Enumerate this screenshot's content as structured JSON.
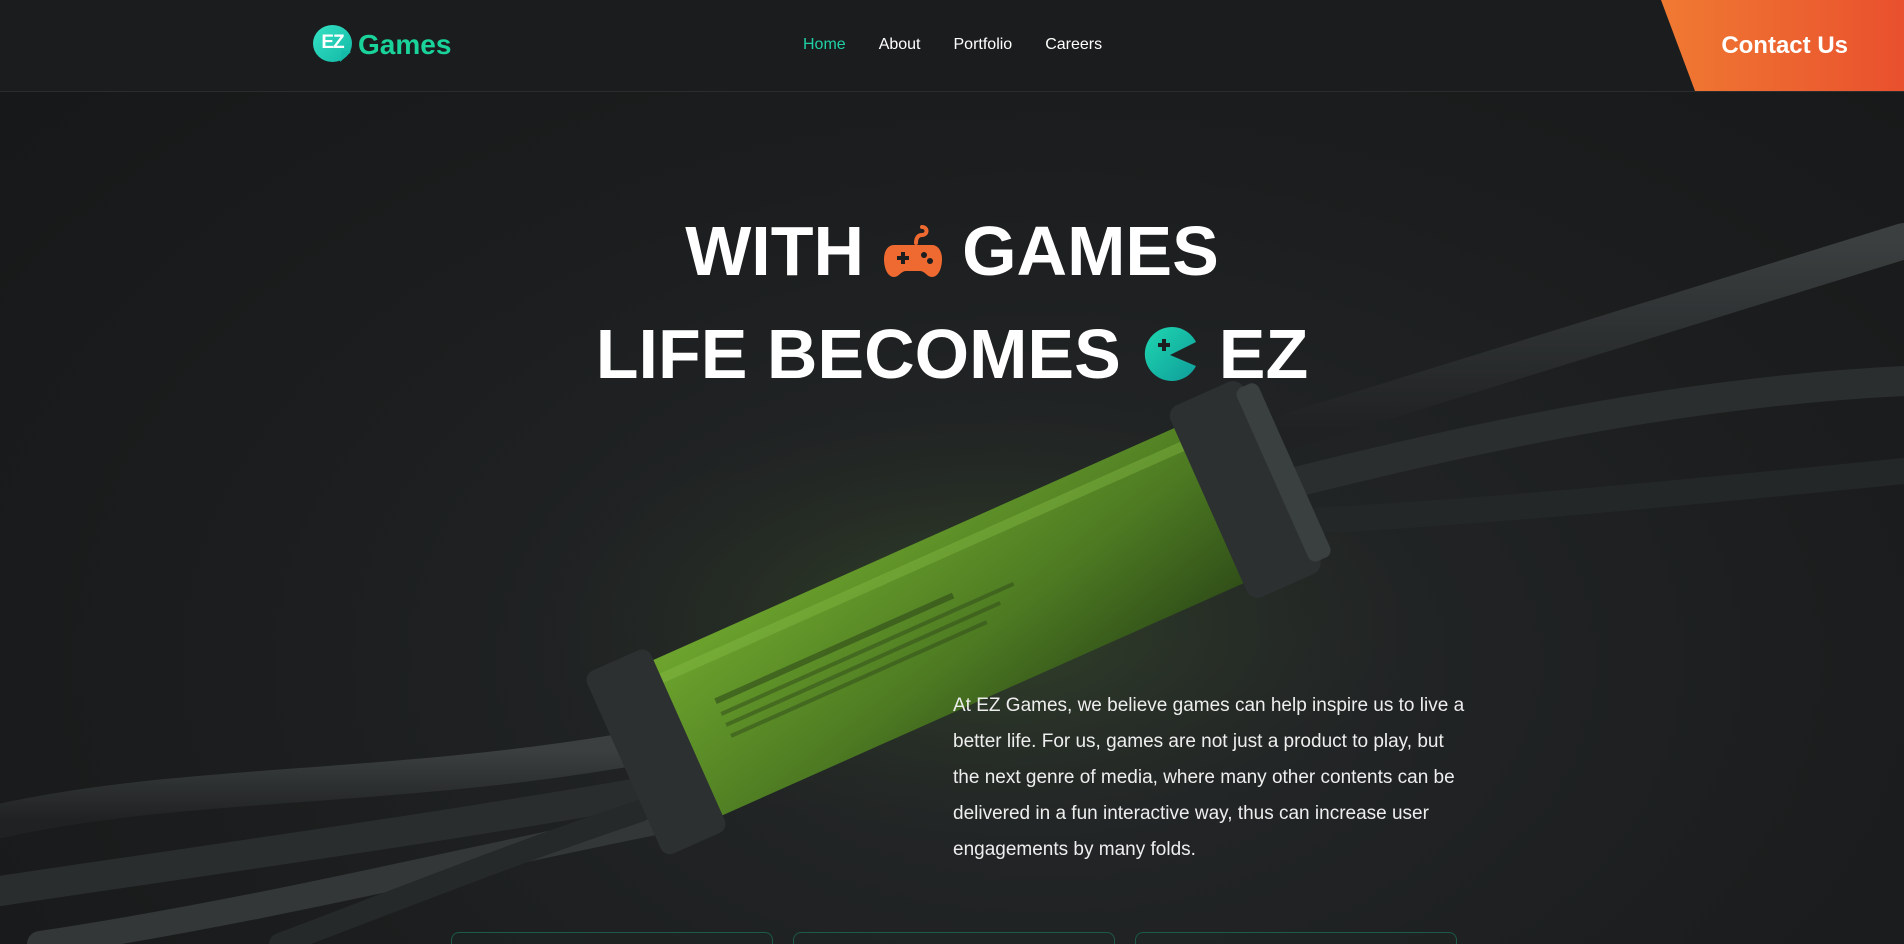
{
  "header": {
    "logo": {
      "badge_text": "EZ",
      "wordmark": "Games"
    },
    "nav": {
      "items": [
        {
          "label": "Home",
          "active": true
        },
        {
          "label": "About",
          "active": false
        },
        {
          "label": "Portfolio",
          "active": false
        },
        {
          "label": "Careers",
          "active": false
        }
      ]
    },
    "contact_label": "Contact Us"
  },
  "hero": {
    "line1": {
      "before": "WITH",
      "icon": "gamepad-icon",
      "after": "GAMES"
    },
    "line2": {
      "before": "LIFE BECOMES",
      "icon": "pacman-icon",
      "after": "EZ"
    },
    "description": "At EZ Games, we believe games can help inspire us to live a better life. For us, games are not just a product to play, but the next genre of media, where many other contents can be delivered in a fun interactive way, thus can increase user engagements by many folds."
  },
  "colors": {
    "accent_green": "#1fd0a6",
    "accent_orange": "#ee6a30",
    "background": "#1b1d1e"
  }
}
